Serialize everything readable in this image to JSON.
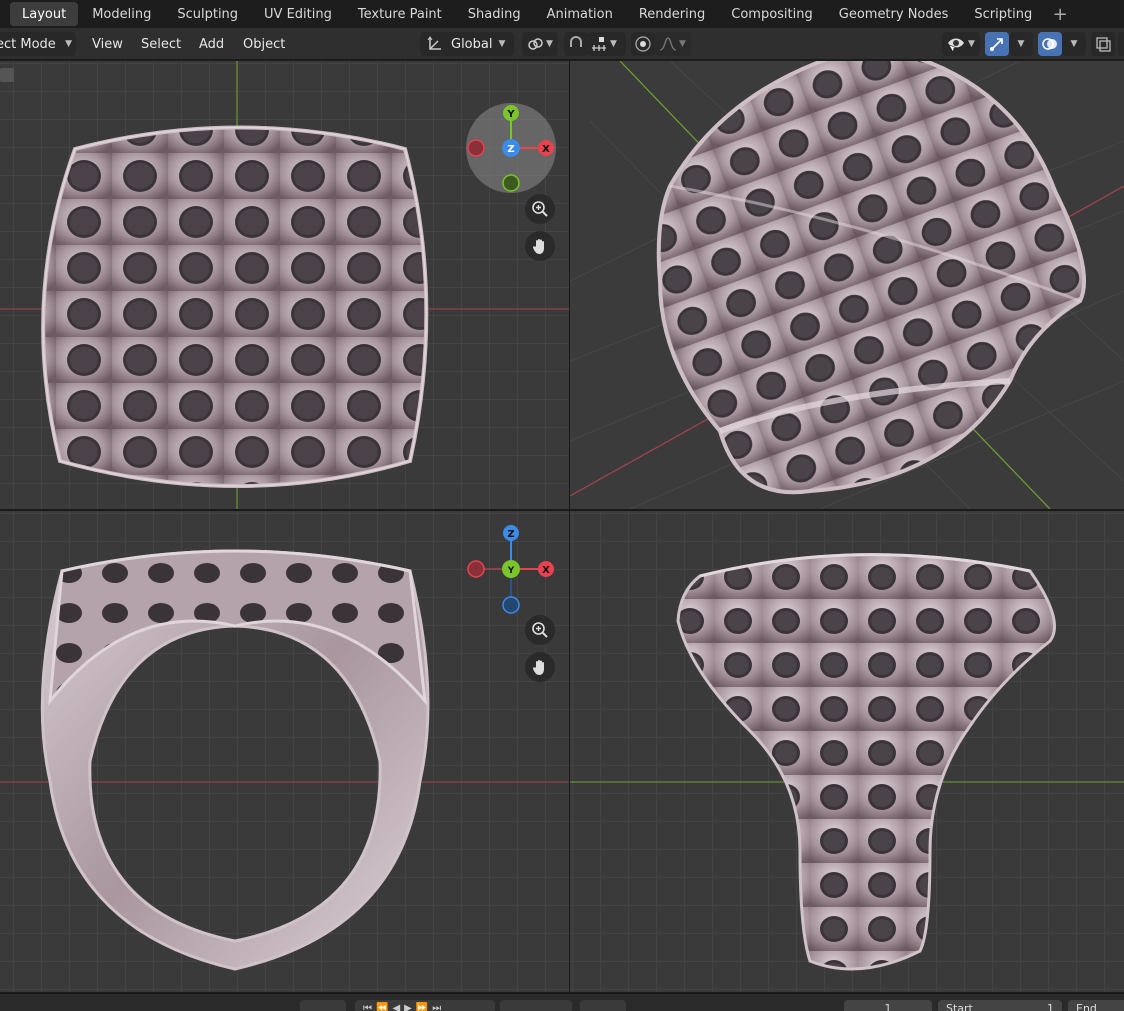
{
  "workspaces": {
    "tabs": [
      "Layout",
      "Modeling",
      "Sculpting",
      "UV Editing",
      "Texture Paint",
      "Shading",
      "Animation",
      "Rendering",
      "Compositing",
      "Geometry Nodes",
      "Scripting"
    ],
    "active": "Layout",
    "add_symbol": "+"
  },
  "header": {
    "mode": "ect Mode",
    "menus": [
      "View",
      "Select",
      "Add",
      "Object"
    ],
    "orientation": "Global"
  },
  "viewports": {
    "top_left": {
      "view": "top",
      "axes": [
        "Y",
        "Z",
        "X"
      ]
    },
    "top_right": {
      "view": "perspective"
    },
    "bottom_left": {
      "view": "front",
      "axes": [
        "Z",
        "Y",
        "X"
      ]
    },
    "bottom_right": {
      "view": "side"
    }
  },
  "timeline": {
    "start_label": "Start",
    "start_value": "1",
    "end_label": "End",
    "current_frame": "1"
  },
  "colors": {
    "accent": "#4772b3",
    "axis_x": "#e8424f",
    "axis_y": "#7bc42a",
    "axis_z": "#3c8be6",
    "ring_metal": "#b9a8b0"
  }
}
